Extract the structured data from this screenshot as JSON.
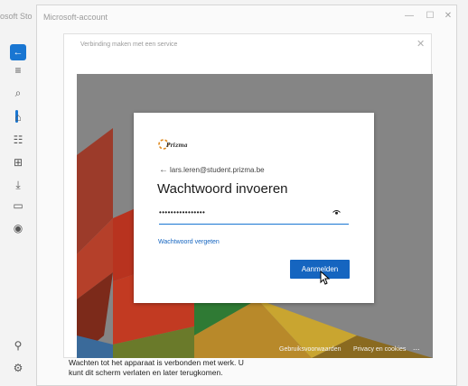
{
  "store": {
    "title": "osoft Sto",
    "rail_icons": [
      "back-arrow",
      "menu",
      "search",
      "home",
      "apps",
      "gaming",
      "downloads",
      "library",
      "movies",
      "account",
      "settings"
    ]
  },
  "account_window": {
    "title": "Microsoft-account",
    "controls": {
      "minimize": "—",
      "maximize": "☐",
      "close": "✕"
    }
  },
  "connect_dialog": {
    "title": "Verbinding maken met een service",
    "close": "✕",
    "footer": {
      "terms": "Gebruiksvoorwaarden",
      "privacy": "Privacy en cookies",
      "more": "..."
    }
  },
  "signin": {
    "logo_text": "Prizma",
    "back_arrow": "←",
    "email": "lars.leren@student.prizma.be",
    "heading": "Wachtwoord invoeren",
    "password_mask": "••••••••••••••••",
    "reveal_icon": "👁",
    "forgot_link": "Wachtwoord vergeten",
    "submit": "Aanmelden"
  },
  "status_text": "Wachten tot het apparaat is verbonden met werk. U kunt dit scherm verlaten en later terugkomen.",
  "colors": {
    "accent": "#1565c0",
    "wallpaper": "#858585",
    "link": "#1565c0"
  }
}
